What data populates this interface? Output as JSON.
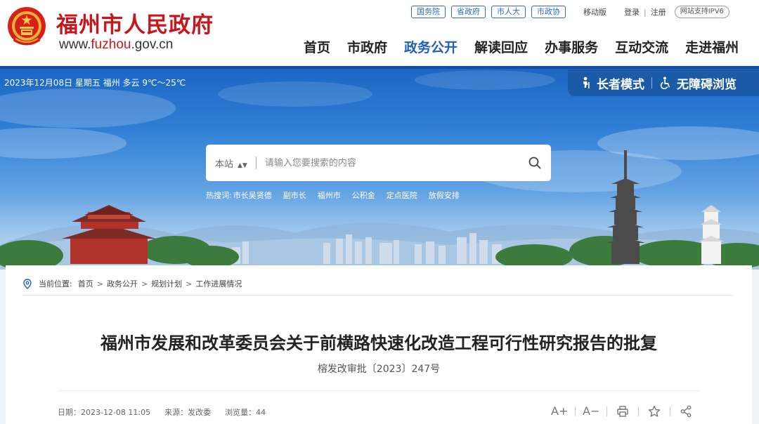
{
  "header": {
    "site_name": "福州市人民政府",
    "url_prefix": "www.",
    "url_accent": "fuzhou",
    "url_suffix": ".gov.cn",
    "emblem_icon": "national-emblem-icon",
    "org_links": [
      "国务院",
      "省政府",
      "市人大",
      "市政协"
    ],
    "mobile": "移动版",
    "login": "登录",
    "divider": "|",
    "register": "注册",
    "ipv6": "网站支持IPV6",
    "nav": [
      "首页",
      "市政府",
      "政务公开",
      "解读回应",
      "办事服务",
      "互动交流",
      "走进福州"
    ],
    "active_nav": "政务公开"
  },
  "banner": {
    "date_weather": "2023年12月08日 星期五   福州 多云 9℃～25℃",
    "elder_mode": "长者模式",
    "accessible": "无障碍浏览",
    "search": {
      "scope": "本站",
      "placeholder": "请输入您要搜索的内容",
      "icon": "search-icon"
    },
    "hot_label": "热搜词:",
    "hot_words": [
      "市长吴贤德",
      "副市长",
      "福州市",
      "公积金",
      "定点医院",
      "放假安排"
    ]
  },
  "breadcrumb": {
    "label": "当前位置:",
    "items": [
      "首页",
      "政务公开",
      "规划计划",
      "工作进展情况"
    ],
    "separator": ">"
  },
  "article": {
    "title": "福州市发展和改革委员会关于前横路快速化改造工程可行性研究报告的批复",
    "doc_number": "榕发改审批〔2023〕247号",
    "date": "日期：2023-12-08 11:05",
    "source": "来源：发改委",
    "views": "浏览量：44",
    "font_increase": "A+",
    "font_decrease": "A−"
  },
  "colors": {
    "brand_red": "#c8161d",
    "nav_active": "#1f5fb8",
    "access_bar": "#1b5aa6"
  }
}
